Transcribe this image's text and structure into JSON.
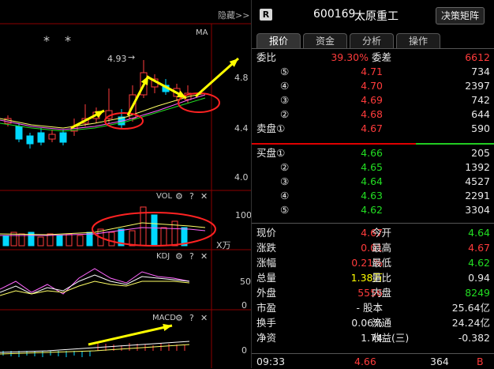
{
  "chart": {
    "hide_label": "隐藏>>",
    "ma_label": "MA",
    "peak_label": "4.93",
    "stars": [
      "*",
      "*"
    ],
    "price_axis": [
      "4.8",
      "4.4",
      "4.0"
    ],
    "vol": {
      "label": "VOL",
      "axis": [
        "100"
      ],
      "unit": "X万"
    },
    "kdj": {
      "label": "KDJ",
      "axis": [
        "50",
        "0"
      ]
    },
    "macd": {
      "label": "MACD",
      "axis": [
        "0"
      ]
    },
    "panel_icons": [
      "gear-icon",
      "help-icon",
      "close-icon"
    ],
    "colors": {
      "up": "#ff3b3b",
      "down": "#00d8ff",
      "arrow": "#ffff00",
      "circle": "#ff2222"
    }
  },
  "header": {
    "badge": "R",
    "code": "600169",
    "name": "太原重工",
    "decision_button": "决策矩阵"
  },
  "tabs": [
    {
      "label": "报价",
      "active": true
    },
    {
      "label": "资金",
      "active": false
    },
    {
      "label": "分析",
      "active": false
    },
    {
      "label": "操作",
      "active": false
    }
  ],
  "order_ratio": {
    "label_ratio": "委比",
    "ratio": "39.30%",
    "label_diff": "委差",
    "diff": "6612"
  },
  "sell_orders": [
    {
      "level": "⑤",
      "price": "4.71",
      "volume": "734"
    },
    {
      "level": "④",
      "price": "4.70",
      "volume": "2397"
    },
    {
      "level": "③",
      "price": "4.69",
      "volume": "742"
    },
    {
      "level": "②",
      "price": "4.68",
      "volume": "644"
    },
    {
      "level": "卖盘①",
      "price": "4.67",
      "volume": "590"
    }
  ],
  "buy_orders": [
    {
      "level": "买盘①",
      "price": "4.66",
      "volume": "205"
    },
    {
      "level": "②",
      "price": "4.65",
      "volume": "1392"
    },
    {
      "level": "③",
      "price": "4.64",
      "volume": "4527"
    },
    {
      "level": "④",
      "price": "4.63",
      "volume": "2291"
    },
    {
      "level": "⑤",
      "price": "4.62",
      "volume": "3304"
    }
  ],
  "stats": [
    {
      "l1": "现价",
      "v1": "4.67",
      "c1": "red",
      "l2": "今开",
      "v2": "4.64",
      "c2": "green"
    },
    {
      "l1": "涨跌",
      "v1": "0.01",
      "c1": "red",
      "l2": "最高",
      "v2": "4.67",
      "c2": "red"
    },
    {
      "l1": "涨幅",
      "v1": "0.21%",
      "c1": "red",
      "l2": "最低",
      "v2": "4.62",
      "c2": "green"
    },
    {
      "l1": "总量",
      "v1": "1.38万",
      "c1": "yellow",
      "l2": "量比",
      "v2": "0.94",
      "c2": "white"
    },
    {
      "l1": "外盘",
      "v1": "5556",
      "c1": "red",
      "l2": "内盘",
      "v2": "8249",
      "c2": "green"
    },
    {
      "l1": "市盈",
      "v1": "- 股本",
      "c1": "white",
      "l2": "",
      "v2": "25.64亿",
      "c2": "white"
    },
    {
      "l1": "换手",
      "v1": "0.06%",
      "c1": "white",
      "l2": "流通",
      "v2": "24.24亿",
      "c2": "white"
    },
    {
      "l1": "净资",
      "v1": "1.74",
      "c1": "white",
      "l2": "收益(三)",
      "v2": "-0.382",
      "c2": "white"
    }
  ],
  "tick": {
    "time": "09:33",
    "price": "4.66",
    "volume": "364",
    "side": "B"
  }
}
